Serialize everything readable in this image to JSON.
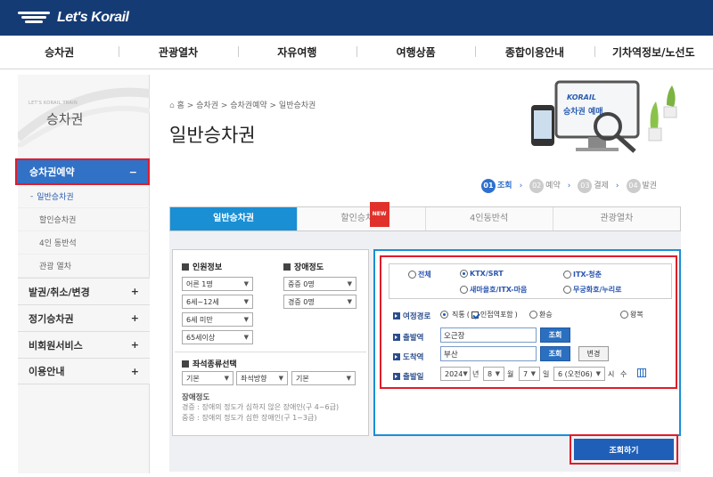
{
  "header": {
    "logo_text": "Let's Korail"
  },
  "nav": [
    "승차권",
    "관광열차",
    "자유여행",
    "여행상품",
    "종합이용안내",
    "기차역정보/노선도"
  ],
  "sidebar": {
    "subtitle": "LET'S KORAIL TRAIN",
    "title": "승차권",
    "active": {
      "label": "승차권예약",
      "toggle": "−"
    },
    "subitems": [
      "일반승차권",
      "할인승차권",
      "4인 동반석",
      "관광 열차"
    ],
    "menus": [
      {
        "label": "발권/취소/변경",
        "toggle": "+"
      },
      {
        "label": "정기승차권",
        "toggle": "+"
      },
      {
        "label": "비회원서비스",
        "toggle": "+"
      },
      {
        "label": "이용안내",
        "toggle": "+"
      }
    ]
  },
  "breadcrumb": [
    "홈",
    "승차권",
    "승차권예약",
    "일반승차권"
  ],
  "page_title": "일반승차권",
  "banner": {
    "brand": "KORAIL",
    "text": "승차권 예매"
  },
  "steps": [
    {
      "num": "01",
      "label": "조회"
    },
    {
      "num": "02",
      "label": "예약"
    },
    {
      "num": "03",
      "label": "결제"
    },
    {
      "num": "04",
      "label": "발권"
    }
  ],
  "tabs": [
    "일반승차권",
    "할인승차권",
    "4인동반석",
    "관광열차"
  ],
  "new_badge": "NEW",
  "passenger": {
    "title": "인원정보",
    "selects": [
      "어른 1명",
      "6세~12세",
      "6세 미만",
      "65세이상"
    ]
  },
  "disability": {
    "title": "장애정도",
    "selects": [
      "중증 0명",
      "경증 0명"
    ]
  },
  "seat": {
    "title": "좌석종류선택",
    "selects": [
      "기본",
      "좌석방향",
      "기본"
    ]
  },
  "disability_note": {
    "title": "장애정도",
    "lines": [
      "경증 : 장애의 정도가 심하지 않은 장애인(구 4~6급)",
      "중증 : 장애의 정도가 심한 장애인(구 1~3급)"
    ]
  },
  "train_types": [
    "전체",
    "KTX/SRT",
    "ITX-청춘",
    "새마을호/ITX-마음",
    "무궁화호/누리로"
  ],
  "route": {
    "label": "여정경로",
    "options": [
      "직통",
      "인접역포함",
      "환승",
      "왕복"
    ]
  },
  "departure": {
    "label": "출발역",
    "value": "오근장",
    "button": "조회"
  },
  "arrival": {
    "label": "도착역",
    "value": "부산",
    "button": "조회",
    "change": "변경"
  },
  "date": {
    "label": "출발일",
    "year": "2024",
    "year_unit": "년",
    "month": "8",
    "month_unit": "월",
    "day": "7",
    "day_unit": "일",
    "hour": "6 (오전06)",
    "hour_unit": "시",
    "weekday": "수"
  },
  "search_button": "조회하기"
}
